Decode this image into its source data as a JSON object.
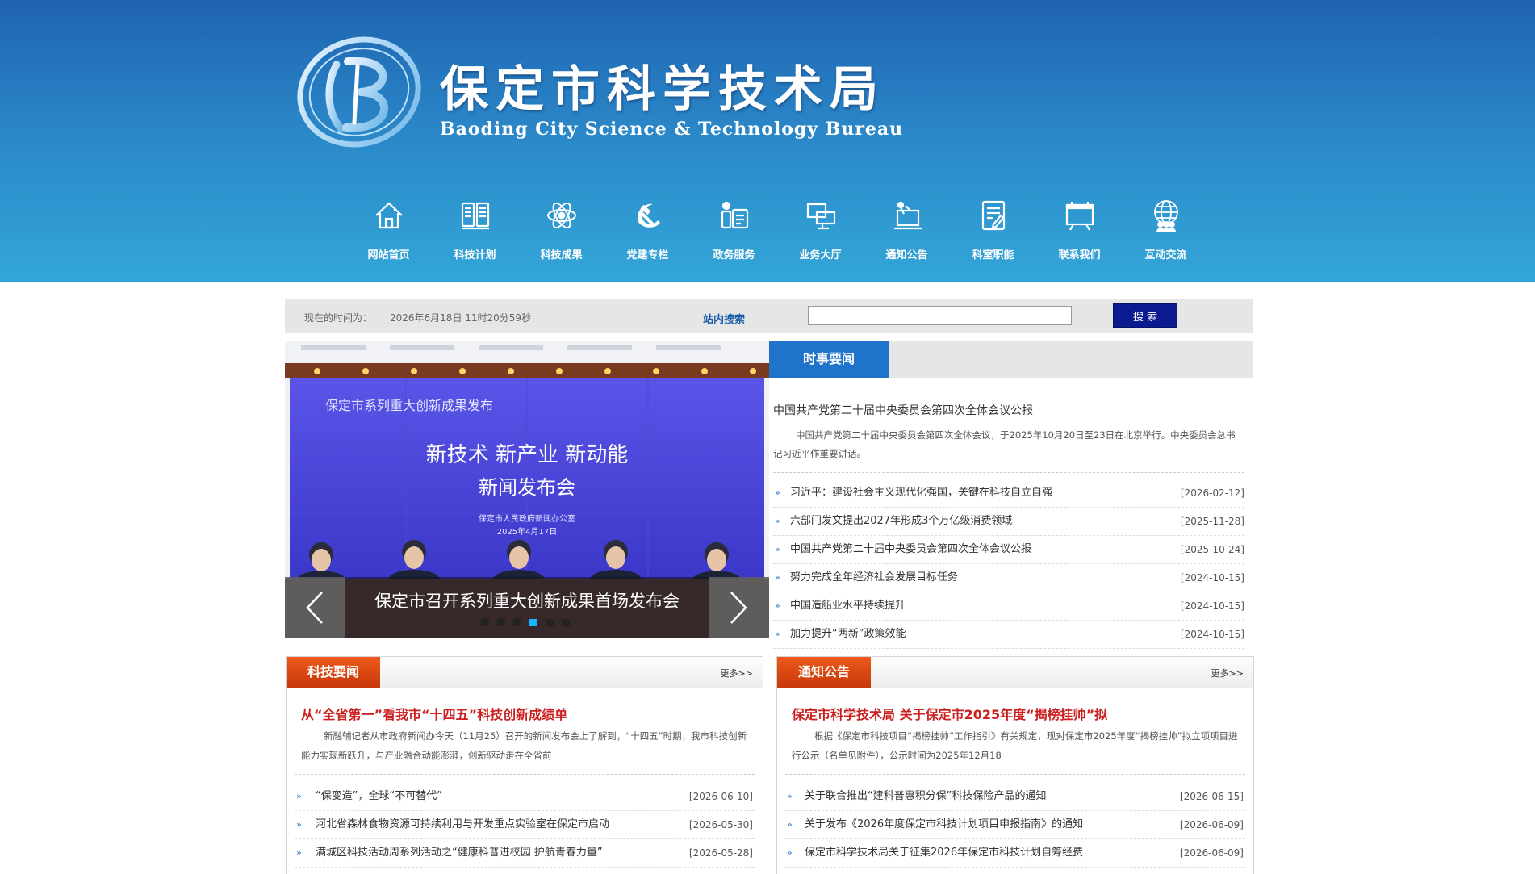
{
  "header": {
    "title": "保定市科学技术局",
    "subtitle": "Baoding City Science & Technology Bureau",
    "colors": {
      "top": "#1f63b0",
      "bottom": "#33a6d8"
    }
  },
  "nav": [
    {
      "label": "网站首页",
      "icon": "home-icon"
    },
    {
      "label": "科技计划",
      "icon": "book-icon"
    },
    {
      "label": "科技成果",
      "icon": "atom-icon"
    },
    {
      "label": "党建专栏",
      "icon": "hammer-sickle-icon"
    },
    {
      "label": "政务服务",
      "icon": "service-icon"
    },
    {
      "label": "业务大厅",
      "icon": "monitors-icon"
    },
    {
      "label": "通知公告",
      "icon": "notice-icon"
    },
    {
      "label": "科室职能",
      "icon": "document-edit-icon"
    },
    {
      "label": "联系我们",
      "icon": "contact-board-icon"
    },
    {
      "label": "互动交流",
      "icon": "globe-people-icon"
    }
  ],
  "toolbar": {
    "time_label": "现在的时间为：",
    "time_value": "2026年6月18日 11时20分59秒",
    "search_label": "站内搜索",
    "search_value": "",
    "search_button": "搜 索"
  },
  "slider": {
    "banner_title": "保定市系列重大创新成果发布",
    "banner_line1": "新技术  新产业  新动能",
    "banner_line2": "新闻发布会",
    "banner_org": "保定市人民政府新闻办公室",
    "banner_date": "2025年4月17日",
    "caption": "保定市召开系列重大创新成果首场发布会",
    "dot_count": 6,
    "active_dot": 4
  },
  "news": {
    "tab": "时事要闻",
    "headline": "中国共产党第二十届中央委员会第四次全体会议公报",
    "summary": "中国共产党第二十届中央委员会第四次全体会议，于2025年10月20日至23日在北京举行。中央委员会总书记习近平作重要讲话。",
    "items": [
      {
        "title": "习近平：建设社会主义现代化强国，关键在科技自立自强",
        "date": "[2026-02-12]"
      },
      {
        "title": "六部门发文提出2027年形成3个万亿级消费领域",
        "date": "[2025-11-28]"
      },
      {
        "title": "中国共产党第二十届中央委员会第四次全体会议公报",
        "date": "[2025-10-24]"
      },
      {
        "title": "努力完成全年经济社会发展目标任务",
        "date": "[2024-10-15]"
      },
      {
        "title": "中国造船业水平持续提升",
        "date": "[2024-10-15]"
      },
      {
        "title": "加力提升“两新”政策效能",
        "date": "[2024-10-15]"
      }
    ]
  },
  "panels": {
    "left": {
      "tab": "科技要闻",
      "more": "更多>>",
      "headline": "从“全省第一”看我市“十四五”科技创新成绩单",
      "summary": "新融辅记者从市政府新闻办今天（11月25）召开的新闻发布会上了解到，“十四五”时期，我市科技创新能力实现新跃升，与产业融合动能澎湃，创新驱动走在全省前",
      "items": [
        {
          "title": "“保变造”，全球“不可替代”",
          "date": "[2026-06-10]"
        },
        {
          "title": "河北省森林食物资源可持续利用与开发重点实验室在保定市启动",
          "date": "[2026-05-30]"
        },
        {
          "title": "满城区科技活动周系列活动之“健康科普进校园 护航青春力量”",
          "date": "[2026-05-28]"
        }
      ]
    },
    "right": {
      "tab": "通知公告",
      "more": "更多>>",
      "headline": "保定市科学技术局 关于保定市2025年度“揭榜挂帅”拟",
      "summary": "根据《保定市科技项目“揭榜挂帅”工作指引》有关规定，现对保定市2025年度“揭榜挂帅”拟立项项目进行公示（名单见附件），公示时间为2025年12月18",
      "items": [
        {
          "title": "关于联合推出“建科普惠积分保”科技保险产品的通知",
          "date": "[2026-06-15]"
        },
        {
          "title": "关于发布《2026年度保定市科技计划项目申报指南》的通知",
          "date": "[2026-06-09]"
        },
        {
          "title": "保定市科学技术局关于征集2026年保定市科技计划自筹经费",
          "date": "[2026-06-09]"
        }
      ]
    }
  }
}
